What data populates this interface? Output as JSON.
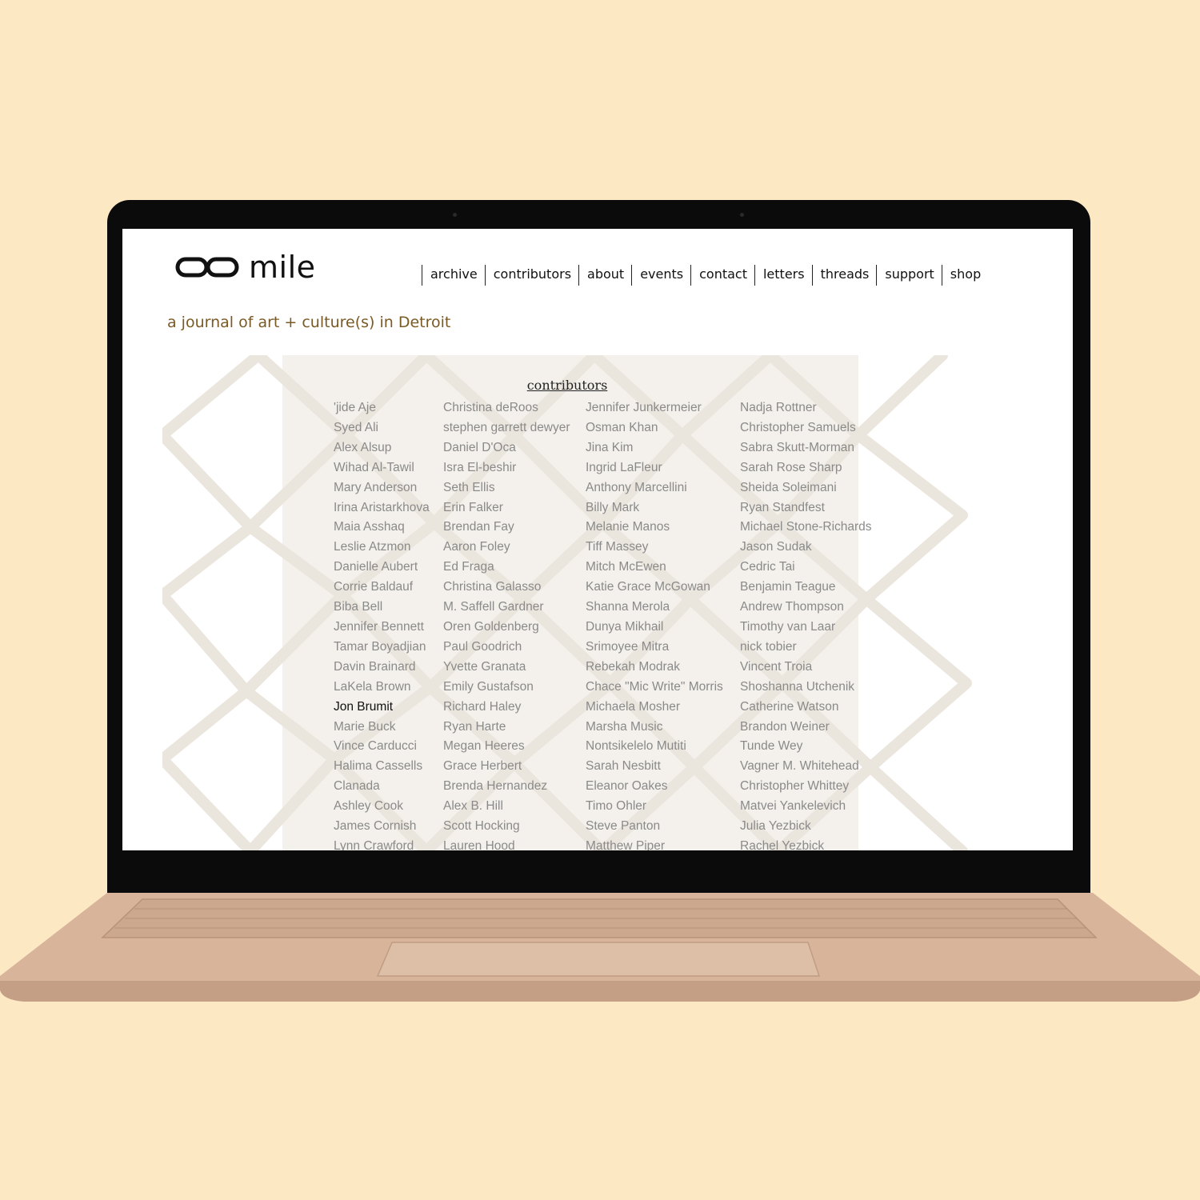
{
  "site": {
    "logo_text": "mile",
    "tagline": "a journal of art + culture(s) in Detroit"
  },
  "nav": {
    "items": [
      "archive",
      "contributors",
      "about",
      "events",
      "contact",
      "letters",
      "threads",
      "support",
      "shop"
    ]
  },
  "contributors": {
    "heading": "contributors",
    "columns": [
      [
        "'jide Aje",
        "Syed Ali",
        "Alex Alsup",
        "Wihad Al-Tawil",
        "Mary Anderson",
        "Irina Aristarkhova",
        "Maia Asshaq",
        "Leslie Atzmon",
        "Danielle Aubert",
        "Corrie Baldauf",
        "Biba Bell",
        "Jennifer Bennett",
        "Tamar Boyadjian",
        "Davin Brainard",
        "LaKela Brown",
        "Jon Brumit",
        "Marie Buck",
        "Vince Carducci",
        "Halima Cassells",
        "Clanada",
        "Ashley Cook",
        "James Cornish",
        "Lynn Crawford"
      ],
      [
        "Christina deRoos",
        "stephen garrett dewyer",
        "Daniel D'Oca",
        "Isra El-beshir",
        "Seth Ellis",
        "Erin Falker",
        "Brendan Fay",
        "Aaron Foley",
        "Ed Fraga",
        "Christina Galasso",
        "M. Saffell Gardner",
        "Oren Goldenberg",
        "Paul Goodrich",
        "Yvette Granata",
        "Emily Gustafson",
        "Richard Haley",
        "Ryan Harte",
        "Megan Heeres",
        "Grace Herbert",
        "Brenda Hernandez",
        "Alex B. Hill",
        "Scott Hocking",
        "Lauren Hood"
      ],
      [
        "Jennifer Junkermeier",
        "Osman Khan",
        "Jina Kim",
        "Ingrid LaFleur",
        "Anthony Marcellini",
        "Billy Mark",
        "Melanie Manos",
        "Tiff Massey",
        "Mitch McEwen",
        "Katie Grace McGowan",
        "Shanna Merola",
        "Dunya Mikhail",
        "Srimoyee Mitra",
        "Rebekah Modrak",
        "Chace \"Mic Write\" Morris",
        "Michaela Mosher",
        "Marsha Music",
        "Nontsikelelo Mutiti",
        "Sarah Nesbitt",
        "Eleanor Oakes",
        "Timo Ohler",
        "Steve Panton",
        "Matthew Piper"
      ],
      [
        "Nadja Rottner",
        "Christopher Samuels",
        "Sabra Skutt-Morman",
        "Sarah Rose Sharp",
        "Sheida Soleimani",
        "Ryan Standfest",
        "Michael Stone-Richards",
        "Jason Sudak",
        "Cedric Tai",
        "Benjamin Teague",
        "Andrew Thompson",
        "Timothy van Laar",
        "nick tobier",
        "Vincent Troia",
        "Shoshanna Utchenik",
        "Catherine Watson",
        "Brandon Weiner",
        "Tunde Wey",
        "Vagner M. Whitehead",
        "Christopher Whittey",
        "Matvei Yankelevich",
        "Julia Yezbick",
        "Rachel Yezbick"
      ]
    ],
    "active_name": "Jon Brumit"
  },
  "colors": {
    "background": "#fde8c4",
    "tagline": "#7a5a24",
    "name_text": "#8a8a8a",
    "name_active": "#111111",
    "laptop_body": "#d8b49a"
  }
}
